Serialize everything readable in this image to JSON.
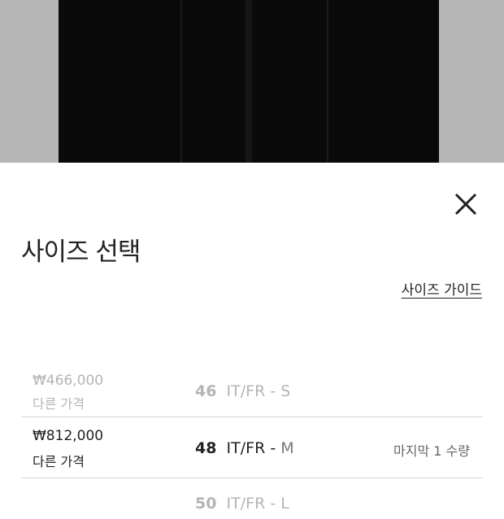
{
  "sheet": {
    "title": "사이즈 선택",
    "size_guide_label": "사이즈 가이드",
    "close_icon": "close-icon"
  },
  "sizes": [
    {
      "price": "₩466,000",
      "price_note": "다른 가격",
      "size_num": "46",
      "system": "IT/FR",
      "dash": "-",
      "letter": "S",
      "stock": "",
      "available": false
    },
    {
      "price": "₩812,000",
      "price_note": "다른 가격",
      "size_num": "48",
      "system": "IT/FR",
      "dash": "-",
      "letter": "M",
      "stock": "마지막 1 수량",
      "available": true
    },
    {
      "price": "",
      "price_note": "",
      "size_num": "50",
      "system": "IT/FR",
      "dash": "-",
      "letter": "L",
      "stock": "",
      "available": false
    }
  ],
  "colors": {
    "hero_bg": "#b6b6b6",
    "garment": "#0a0a0a",
    "divider": "#d8d8d8"
  }
}
